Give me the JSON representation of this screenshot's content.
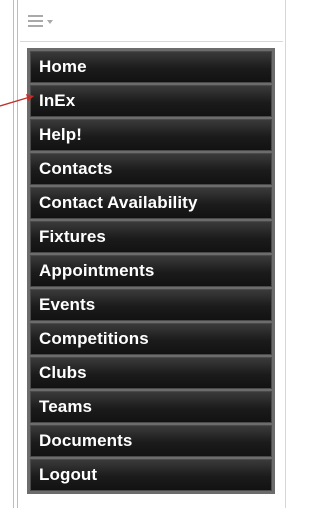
{
  "colors": {
    "menu_background": "#6c6c6c",
    "menu_item_background": "#1b1b1b",
    "menu_item_text": "#ffffff",
    "arrow": "#c0302b"
  },
  "toolbar": {
    "menu_icon": "hamburger-icon",
    "dropdown_icon": "caret-down-icon"
  },
  "menu": {
    "items": [
      {
        "label": "Home"
      },
      {
        "label": "InEx"
      },
      {
        "label": "Help!"
      },
      {
        "label": "Contacts"
      },
      {
        "label": "Contact Availability"
      },
      {
        "label": "Fixtures"
      },
      {
        "label": "Appointments"
      },
      {
        "label": "Events"
      },
      {
        "label": "Competitions"
      },
      {
        "label": "Clubs"
      },
      {
        "label": "Teams"
      },
      {
        "label": "Documents"
      },
      {
        "label": "Logout"
      }
    ]
  },
  "annotation": {
    "arrow_icon": "arrow-right-icon",
    "target_item": "InEx"
  }
}
